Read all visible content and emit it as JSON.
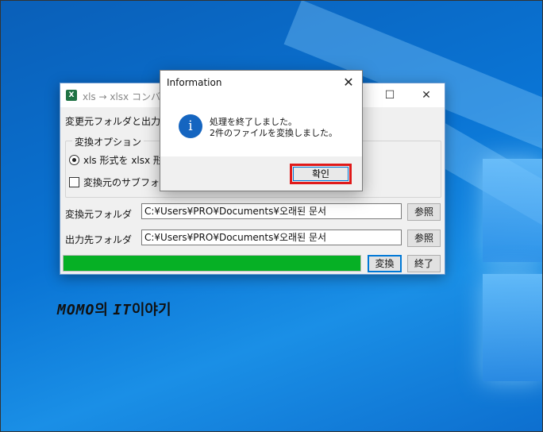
{
  "main_window": {
    "title": "xls → xlsx コンバー",
    "icon_letter": "X",
    "minimize": "—",
    "maximize": "☐",
    "close": "✕",
    "description": "変更元フォルダと出力先フ",
    "options": {
      "group_title": "変換オプション",
      "radio_xls": "xls 形式を xlsx 形式",
      "check_subfolder": "変換元のサブフォルダ"
    },
    "source": {
      "label": "変換元フォルダ",
      "value": "C:¥Users¥PRO¥Documents¥오래된 문서",
      "browse": "参照"
    },
    "output": {
      "label": "出力先フォルダ",
      "value": "C:¥Users¥PRO¥Documents¥오래된 문서",
      "browse": "参照"
    },
    "progress_percent": 100,
    "convert_button": "変換",
    "exit_button": "終了"
  },
  "dialog": {
    "title": "Information",
    "close": "✕",
    "icon_glyph": "i",
    "line1": "処理を終了しました。",
    "line2": "2件のファイルを変換しました。",
    "ok_button": "확인"
  },
  "watermark": {
    "part1": "MOMO",
    "part2": "의 ",
    "part3": "IT",
    "part4": "이야기"
  },
  "colors": {
    "progress": "#06b025",
    "highlight": "#e01a1a",
    "info_icon": "#1565c0"
  }
}
